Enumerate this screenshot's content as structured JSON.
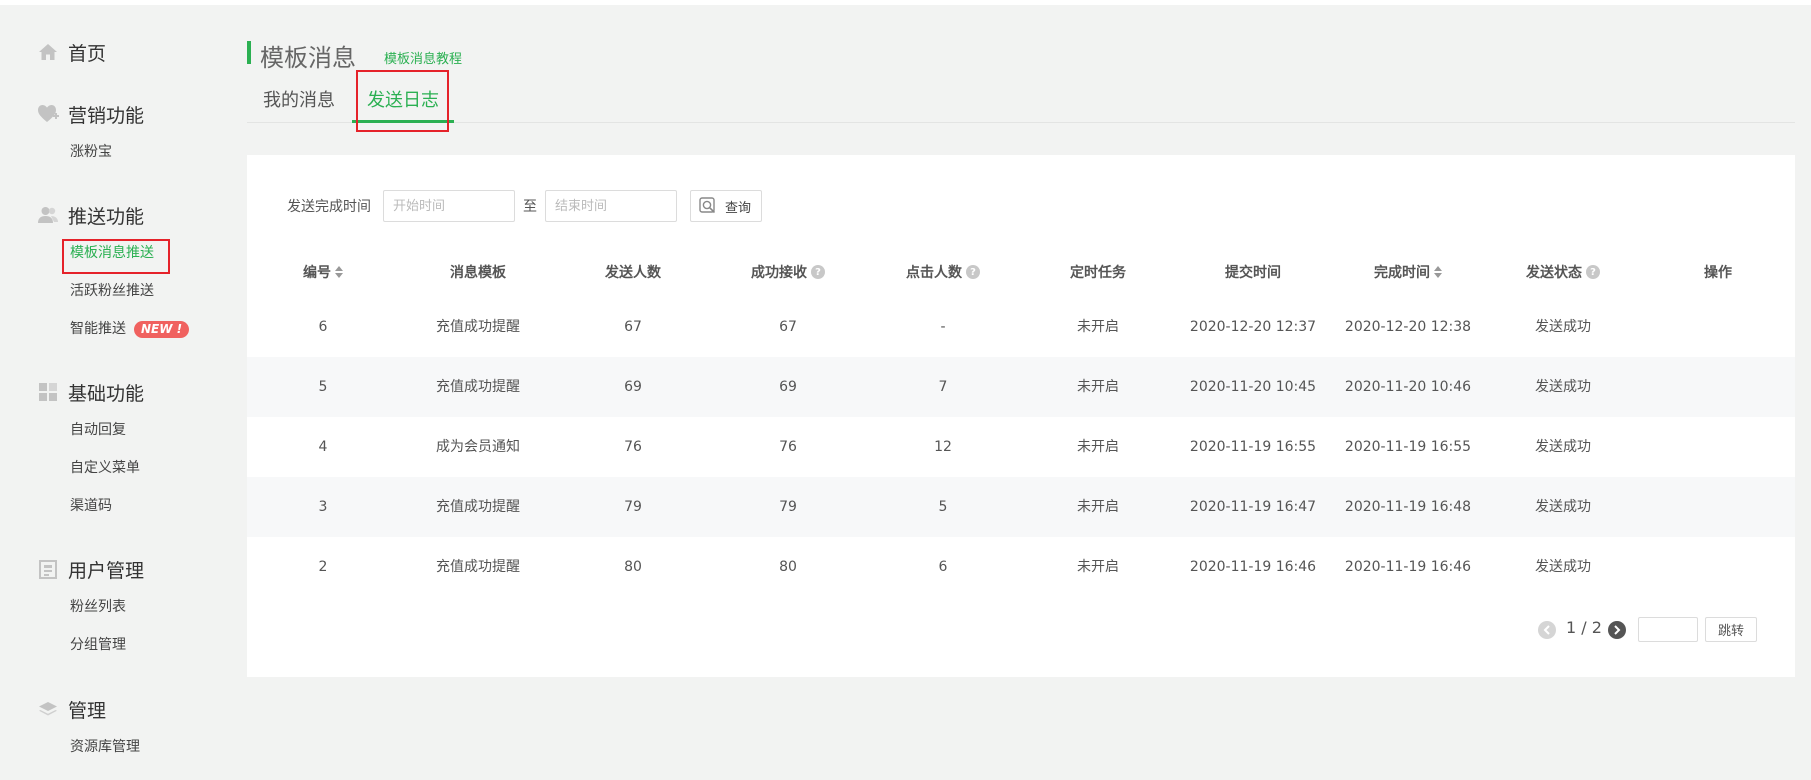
{
  "sidebar": {
    "home": {
      "label": "首页",
      "icon": "home-icon"
    },
    "marketing": {
      "label": "营销功能",
      "icon": "heart-plus-icon",
      "items": [
        "涨粉宝"
      ]
    },
    "push": {
      "label": "推送功能",
      "icon": "users-icon",
      "items": [
        "模板消息推送",
        "活跃粉丝推送",
        "智能推送"
      ],
      "new_badge": "NEW !"
    },
    "basic": {
      "label": "基础功能",
      "icon": "grid-icon",
      "items": [
        "自动回复",
        "自定义菜单",
        "渠道码"
      ]
    },
    "users": {
      "label": "用户管理",
      "icon": "contact-card-icon",
      "items": [
        "粉丝列表",
        "分组管理"
      ]
    },
    "manage": {
      "label": "管理",
      "icon": "layers-icon",
      "items": [
        "资源库管理"
      ]
    }
  },
  "header": {
    "title": "模板消息",
    "tutorial_link": "模板消息教程",
    "tabs": [
      "我的消息",
      "发送日志"
    ]
  },
  "filter": {
    "label": "发送完成时间",
    "start_placeholder": "开始时间",
    "to": "至",
    "end_placeholder": "结束时间",
    "query_label": "查询"
  },
  "table": {
    "columns": [
      "编号",
      "消息模板",
      "发送人数",
      "成功接收",
      "点击人数",
      "定时任务",
      "提交时间",
      "完成时间",
      "发送状态",
      "操作"
    ],
    "rows": [
      [
        "6",
        "充值成功提醒",
        "67",
        "67",
        "-",
        "未开启",
        "2020-12-20 12:37",
        "2020-12-20 12:38",
        "发送成功",
        ""
      ],
      [
        "5",
        "充值成功提醒",
        "69",
        "69",
        "7",
        "未开启",
        "2020-11-20 10:45",
        "2020-11-20 10:46",
        "发送成功",
        ""
      ],
      [
        "4",
        "成为会员通知",
        "76",
        "76",
        "12",
        "未开启",
        "2020-11-19 16:55",
        "2020-11-19 16:55",
        "发送成功",
        ""
      ],
      [
        "3",
        "充值成功提醒",
        "79",
        "79",
        "5",
        "未开启",
        "2020-11-19 16:47",
        "2020-11-19 16:48",
        "发送成功",
        ""
      ],
      [
        "2",
        "充值成功提醒",
        "80",
        "80",
        "6",
        "未开启",
        "2020-11-19 16:46",
        "2020-11-19 16:46",
        "发送成功",
        ""
      ]
    ]
  },
  "pagination": {
    "page_text": "1 / 2",
    "jump_label": "跳转"
  },
  "colors": {
    "accent": "#2bb052",
    "highlight_box": "#e5222a",
    "new_badge": "#f0615f"
  }
}
